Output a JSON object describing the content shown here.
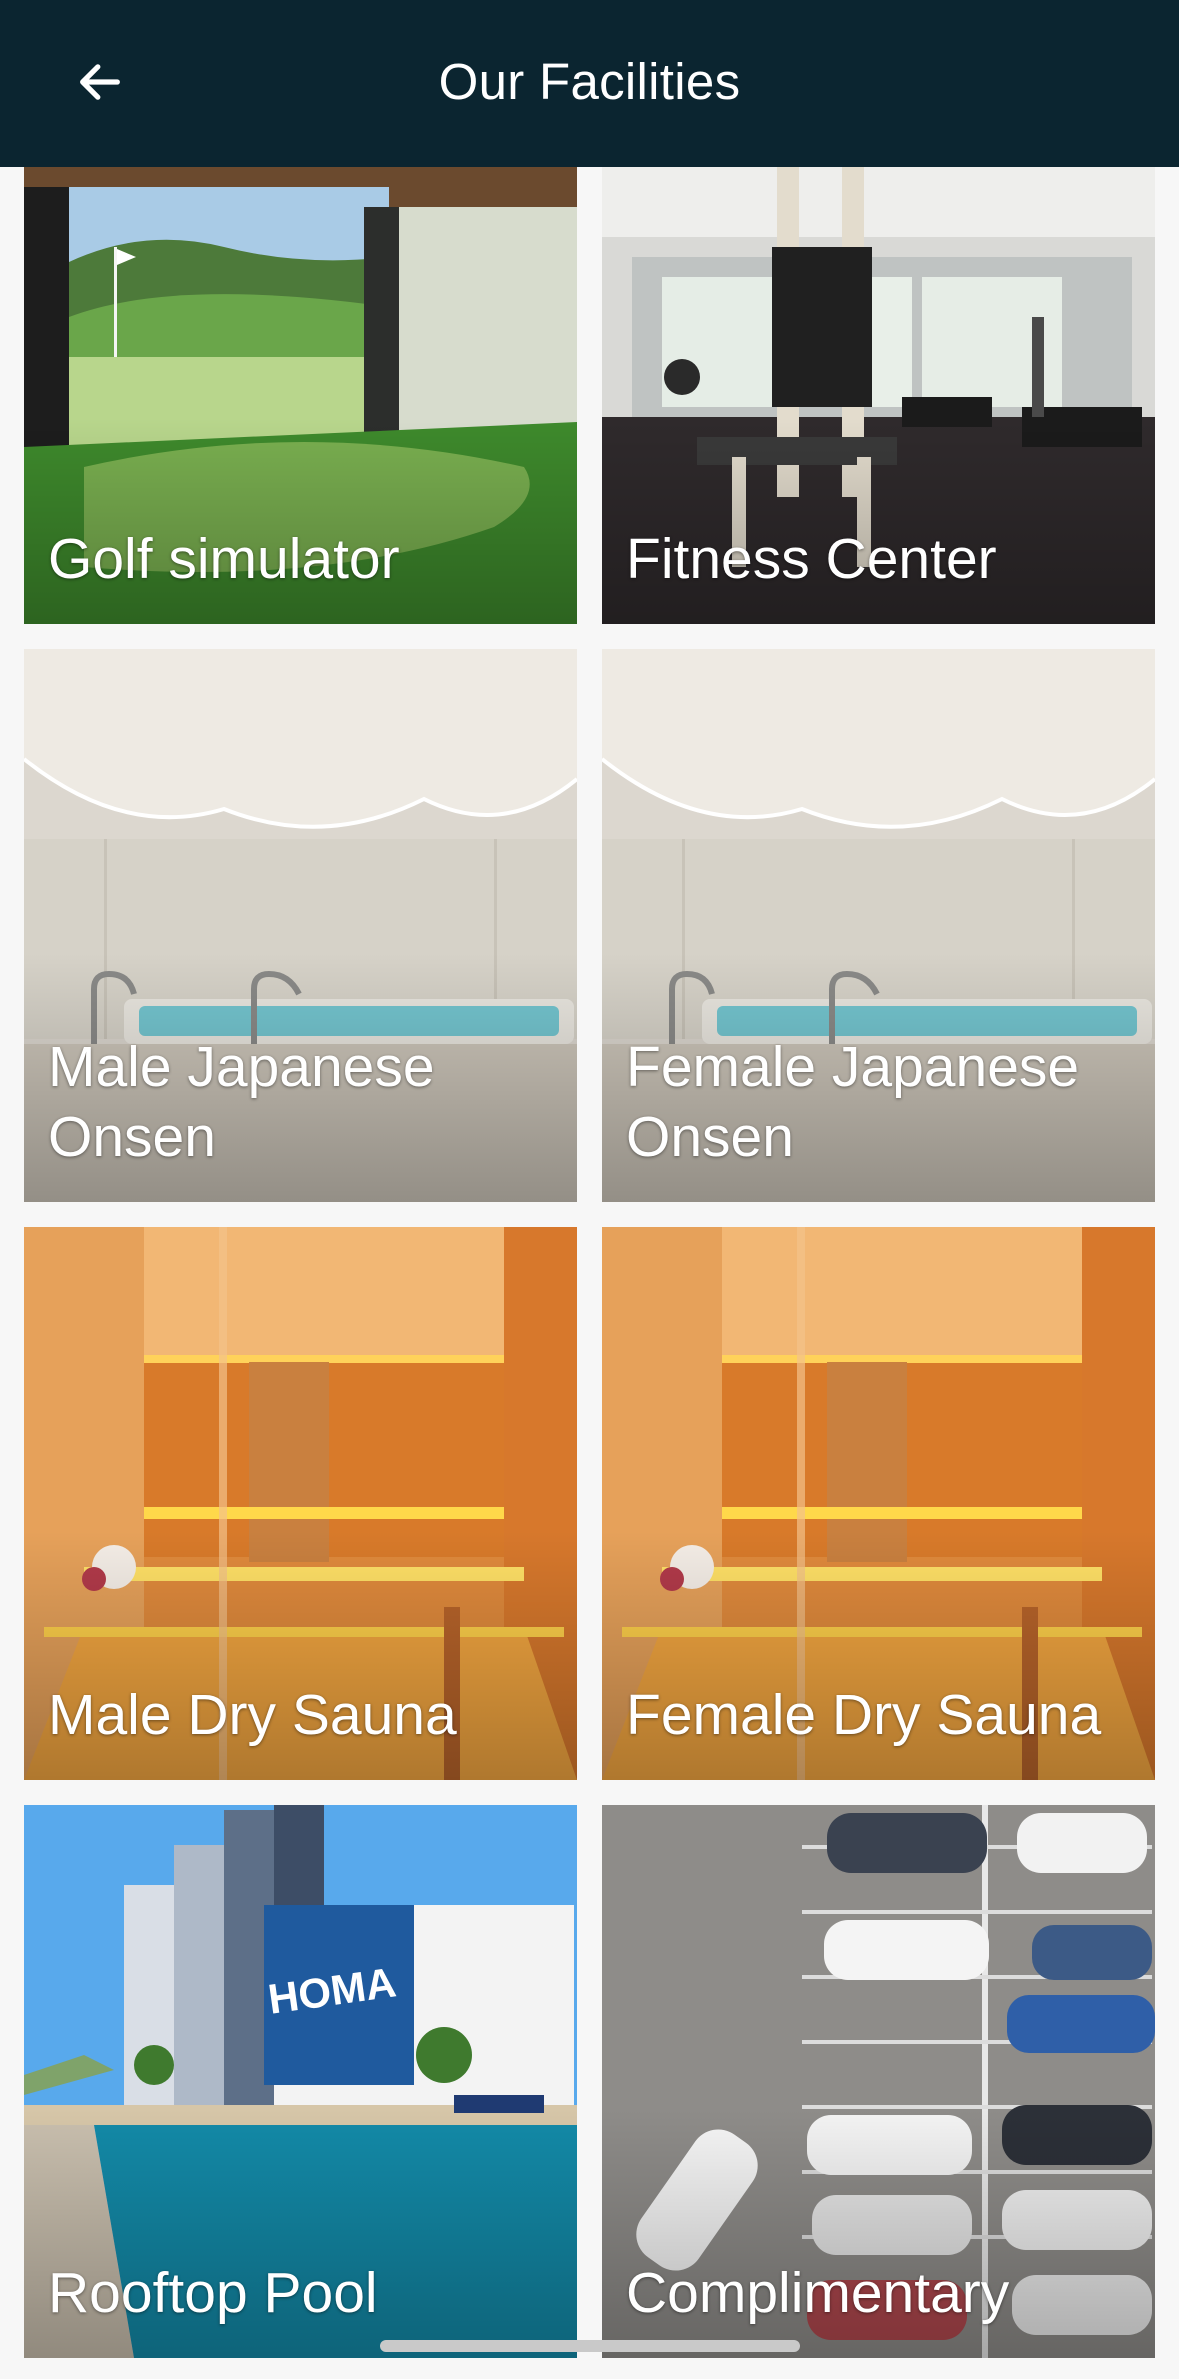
{
  "header": {
    "title": "Our Facilities",
    "back_icon": "arrow-left-icon"
  },
  "facilities": [
    {
      "label": "Golf simulator"
    },
    {
      "label": "Fitness Center"
    },
    {
      "label": "Male Japanese Onsen"
    },
    {
      "label": "Female Japanese Onsen"
    },
    {
      "label": "Male Dry Sauna"
    },
    {
      "label": "Female Dry Sauna"
    },
    {
      "label": "Rooftop Pool",
      "image_text": "HOMA"
    },
    {
      "label": "Complimentary"
    }
  ],
  "colors": {
    "app_bar": "#0b2530",
    "background": "#f7f7f7",
    "label": "#ffffff"
  }
}
